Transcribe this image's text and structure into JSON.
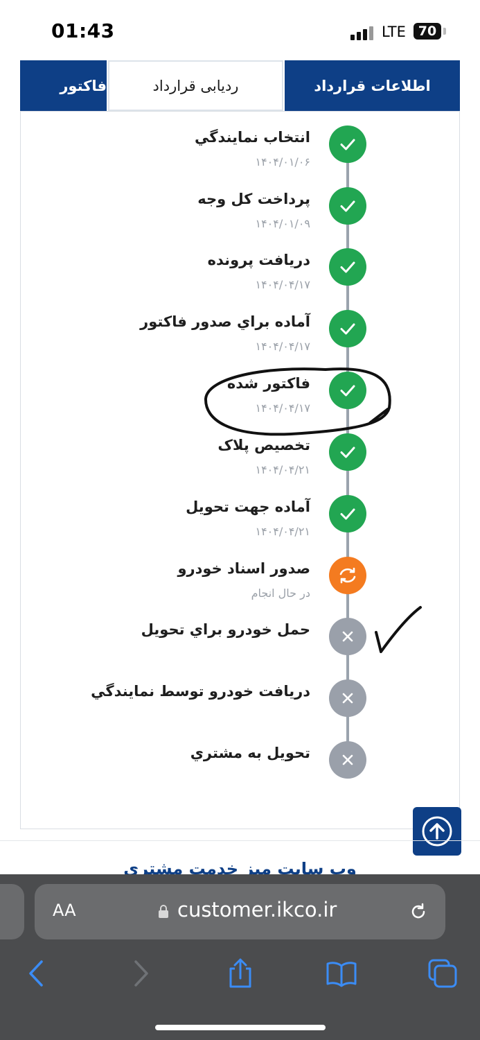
{
  "status_bar": {
    "time": "01:43",
    "network": "LTE",
    "battery": "70"
  },
  "tabs": [
    {
      "label": "اطلاعات قرارداد"
    },
    {
      "label": "ردیابی قرارداد"
    },
    {
      "label": "فاکتور"
    }
  ],
  "steps": [
    {
      "title": "انتخاب نمايندگي",
      "date": "۱۴۰۴/۰۱/۰۶",
      "status": "done"
    },
    {
      "title": "پرداخت کل وجه",
      "date": "۱۴۰۴/۰۱/۰۹",
      "status": "done"
    },
    {
      "title": "دريافت پرونده",
      "date": "۱۴۰۴/۰۴/۱۷",
      "status": "done"
    },
    {
      "title": "آماده براي صدور فاکتور",
      "date": "۱۴۰۴/۰۴/۱۷",
      "status": "done"
    },
    {
      "title": "فاکتور شده",
      "date": "۱۴۰۴/۰۴/۱۷",
      "status": "done"
    },
    {
      "title": "تخصيص پلاک",
      "date": "۱۴۰۴/۰۴/۲۱",
      "status": "done"
    },
    {
      "title": "آماده جهت تحويل",
      "date": "۱۴۰۴/۰۴/۲۱",
      "status": "done"
    },
    {
      "title": "صدور اسناد خودرو",
      "date": "در حال انجام",
      "status": "in-progress"
    },
    {
      "title": "حمل خودرو براي تحويل",
      "date": "",
      "status": "pending"
    },
    {
      "title": "دريافت خودرو توسط نمايندگي",
      "date": "",
      "status": "pending"
    },
    {
      "title": "تحويل به مشتري",
      "date": "",
      "status": "pending"
    }
  ],
  "footer": {
    "text": "وب سایت میز خدمت مشتری"
  },
  "browser": {
    "aa_label": "AA",
    "url": "customer.ikco.ir"
  },
  "colors": {
    "brand": "#0e3f86",
    "done": "#22a652",
    "progress": "#f47b20",
    "pending": "#9aa0aa"
  }
}
